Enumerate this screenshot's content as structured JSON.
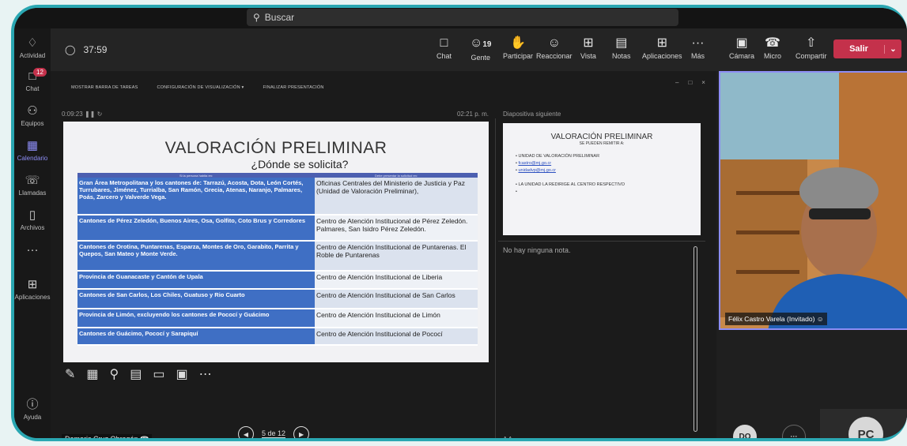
{
  "search": {
    "placeholder": "Buscar"
  },
  "rail": {
    "actividad": "Actividad",
    "chat": "Chat",
    "chat_badge": "12",
    "equipos": "Equipos",
    "calendario": "Calendario",
    "llamadas": "Llamadas",
    "archivos": "Archivos",
    "more": "···",
    "aplicaciones": "Aplicaciones",
    "ayuda": "Ayuda"
  },
  "meeting": {
    "timer": "37:59",
    "toolbar": {
      "chat": "Chat",
      "people_count": "19",
      "gente": "Gente",
      "participar": "Participar",
      "reaccionar": "Reaccionar",
      "vista": "Vista",
      "notas": "Notas",
      "aplicaciones": "Aplicaciones",
      "mas": "Más",
      "mas_icon": "···",
      "camara": "Cámara",
      "micro": "Micro",
      "compartir": "Compartir",
      "salir": "Salir"
    }
  },
  "presenter_view": {
    "tools": {
      "taskbar": "MOSTRAR BARRA DE TAREAS",
      "display_settings": "CONFIGURACIÓN DE VISUALIZACIÓN ▾",
      "end": "FINALIZAR PRESENTACIÓN"
    },
    "elapsed": "0:09:23",
    "clock": "02:21 p. m.",
    "next_label": "Diapositiva siguiente",
    "slide": {
      "title": "VALORACIÓN PRELIMINAR",
      "subtitle": "¿Dónde se solicita?",
      "headers": [
        "Si la persona habita en:",
        "Debe presentar la solicitud en:"
      ],
      "rows": [
        {
          "l": "Gran Área Metropolitana y los cantones de: Tarrazú, Acosta, Dota, León Cortés, Turrubares, Jiménez, Turrialba, San Ramón, Grecia, Atenas, Naranjo, Palmares, Poás, Zarcero y Valverde Vega.",
          "r": "Oficinas Centrales del Ministerio de Justicia y Paz (Unidad de Valoración Preliminar),"
        },
        {
          "l": "Cantones de Pérez Zeledón, Buenos Aires, Osa, Golfito, Coto Brus y Corredores",
          "r": "Centro de Atención Institucional de Pérez Zeledón. Palmares, San Isidro Pérez Zeledón."
        },
        {
          "l": "Cantones de Orotina, Puntarenas, Esparza, Montes de Oro, Garabito, Parrita y Quepos, San Mateo y Monte Verde.",
          "r": "Centro de Atención Institucional de Puntarenas. El Roble de Puntarenas"
        },
        {
          "l": "Provincia de Guanacaste y Cantón de Upala",
          "r": "Centro de Atención Institucional de Liberia"
        },
        {
          "l": "Cantones de San Carlos, Los Chiles, Guatuso y Rio Cuarto",
          "r": "Centro de Atención Institucional de San Carlos"
        },
        {
          "l": "Provincia de Limón, excluyendo los cantones de Pococí y Guácimo",
          "r": "Centro de Atención Institucional de Limón"
        },
        {
          "l": "Cantones de Guácimo, Pococí y Sarapiquí",
          "r": "Centro de Atención Institucional de Pococí"
        }
      ]
    },
    "next_slide": {
      "title": "VALORACIÓN PRELIMINAR",
      "subtitle": "SE PUEDEN REMITIR A:",
      "items": [
        "UNIDAD DE VALORACIÓN PRELIMINAR",
        "fcastro@mj.go.cr",
        "unidadvp@mj.go.cr",
        "LA UNIDAD LA REDIRIGE AL CENTRO RESPECTIVO"
      ]
    },
    "notes": "No hay ninguna nota.",
    "font_ctl": "A  A",
    "page": "5 de 12"
  },
  "video": {
    "name": "Félix Castro Varela (Invitado)"
  },
  "participants": {
    "do": "DO",
    "more": "···",
    "pc": "PC"
  },
  "presenter_name": "Damaris Cruz Obregón",
  "colors": {
    "accent": "#8d8df5",
    "leave": "#c4314b",
    "slide_left": "#3f6fc4"
  }
}
